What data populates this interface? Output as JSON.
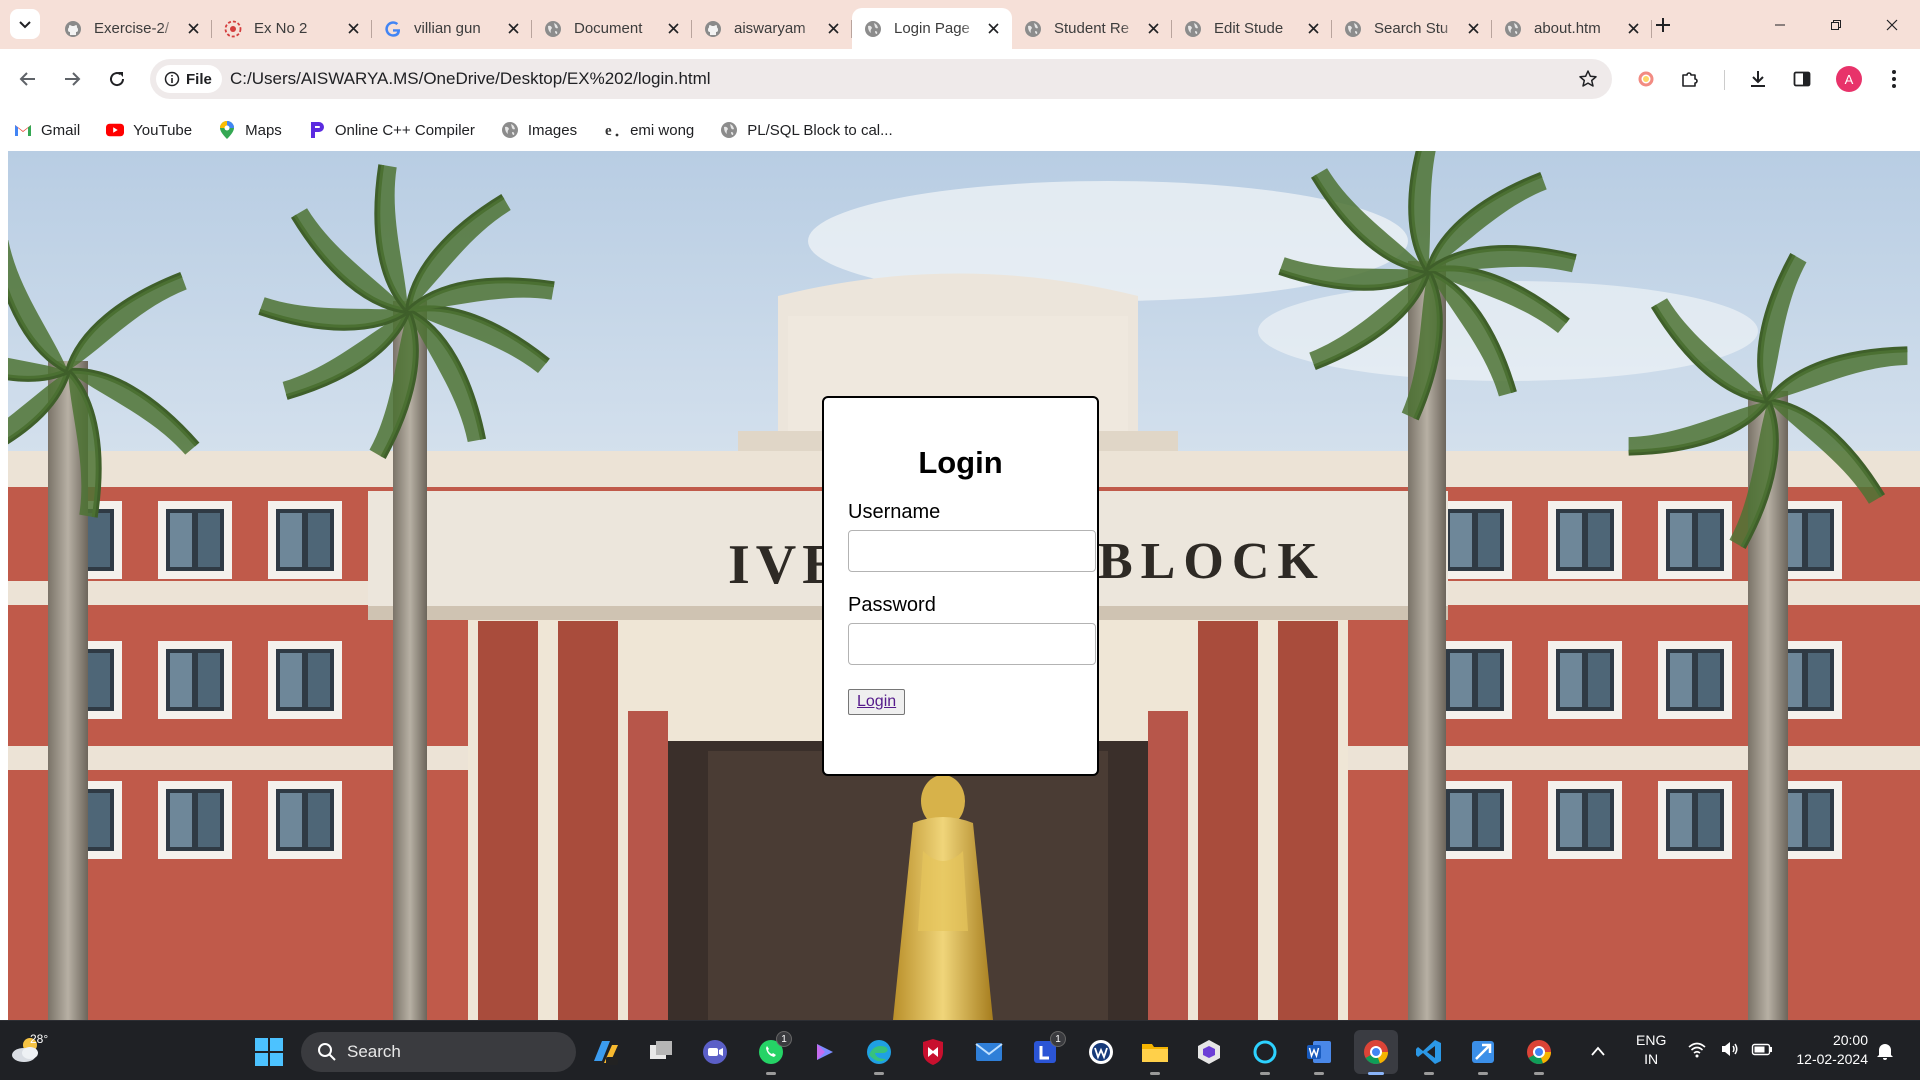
{
  "browser": {
    "tabs": [
      {
        "title": "Exercise-2/",
        "favicon": "github-icon",
        "active": false
      },
      {
        "title": "Ex No 2",
        "favicon": "webpage-favicon",
        "active": false
      },
      {
        "title": "villian gun",
        "favicon": "google-icon",
        "active": false
      },
      {
        "title": "Document",
        "favicon": "globe-icon",
        "active": false
      },
      {
        "title": "aiswaryam",
        "favicon": "github-icon",
        "active": false
      },
      {
        "title": "Login Page",
        "favicon": "globe-icon",
        "active": true
      },
      {
        "title": "Student Re",
        "favicon": "globe-icon",
        "active": false
      },
      {
        "title": "Edit Stude",
        "favicon": "globe-icon",
        "active": false
      },
      {
        "title": "Search Stu",
        "favicon": "globe-icon",
        "active": false
      },
      {
        "title": "about.htm",
        "favicon": "globe-icon",
        "active": false
      }
    ],
    "address": {
      "chip_label": "File",
      "url": "C:/Users/AISWARYA.MS/OneDrive/Desktop/EX%202/login.html"
    },
    "profile_initial": "A",
    "accent_color": "#f6e0d8",
    "bookmarks": [
      {
        "label": "Gmail",
        "icon": "gmail-icon"
      },
      {
        "label": "YouTube",
        "icon": "youtube-icon"
      },
      {
        "label": "Maps",
        "icon": "maps-icon"
      },
      {
        "label": "Online C++ Compiler",
        "icon": "programiz-icon"
      },
      {
        "label": "Images",
        "icon": "globe-icon"
      },
      {
        "label": "emi wong",
        "icon": "emi-icon"
      },
      {
        "label": "PL/SQL Block to cal...",
        "icon": "globe-icon"
      }
    ]
  },
  "page": {
    "heading": "Login",
    "username_label": "Username",
    "username_value": "",
    "password_label": "Password",
    "password_value": "",
    "login_button": "Login",
    "building_sign_left": "IVEK",
    "building_sign_right": "BLOCK"
  },
  "taskbar": {
    "weather_temp": "28°",
    "search_placeholder": "Search",
    "whatsapp_badge": "1",
    "teams_badge": "1",
    "lang_line1": "ENG",
    "lang_line2": "IN",
    "time": "20:00",
    "date": "12-02-2024"
  }
}
